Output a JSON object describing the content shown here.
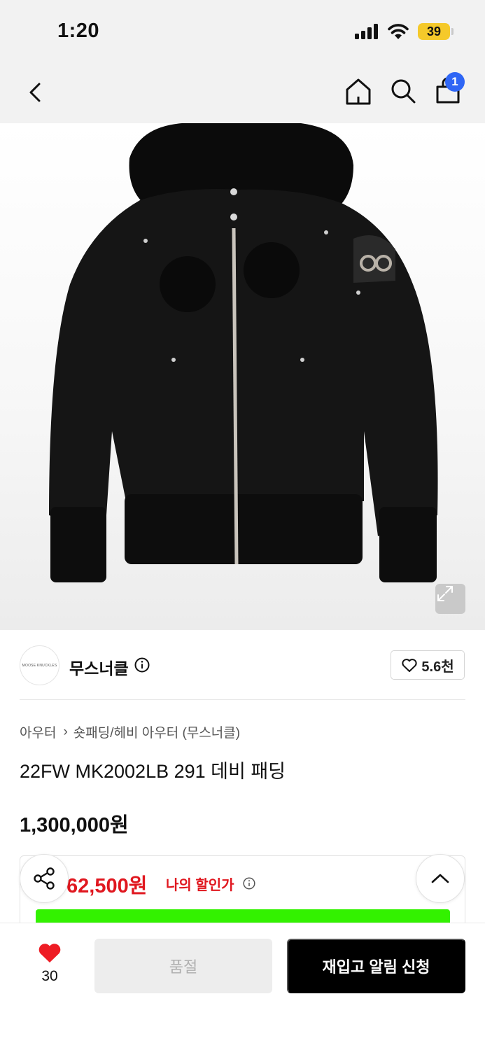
{
  "status_bar": {
    "time": "1:20",
    "battery": "39"
  },
  "nav": {
    "cart_count": "1",
    "icons": [
      "back-icon",
      "home-icon",
      "search-icon",
      "shopping-bag-icon"
    ]
  },
  "product": {
    "image_alt": "black bomber jacket with fur hood",
    "expand_icon": "expand-icon"
  },
  "brand": {
    "name": "무스너클",
    "logo_text": "MOOSE KNUCKLES",
    "like_count": "5.6천"
  },
  "breadcrumb": {
    "items": [
      "아우터",
      "숏패딩/헤비 아우터 (무스너클)"
    ]
  },
  "title": "22FW MK2002LB 291 데비 패딩",
  "price": "1,300,000원",
  "discount": {
    "price": "62,500원",
    "label": "나의 할인가",
    "price_color": "#e0171f",
    "banner_color": "#33f200"
  },
  "bottom_bar": {
    "wish_count": "30",
    "soldout_label": "품절",
    "restock_label": "재입고 알림 신청",
    "heart_color": "#ee1c24"
  }
}
